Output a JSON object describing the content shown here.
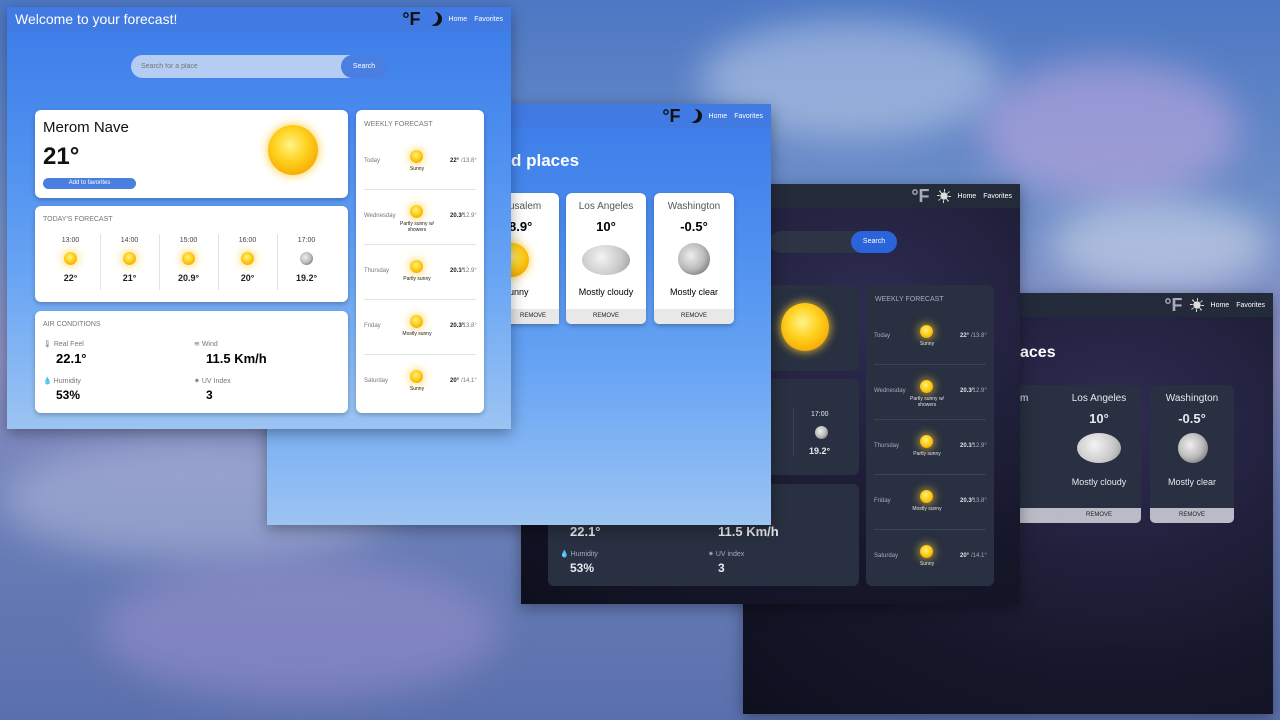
{
  "nav": {
    "title": "Welcome to your forecast!",
    "unit": "°F",
    "home": "Home",
    "favorites": "Favorites"
  },
  "search": {
    "placeholder": "Search for a place",
    "button": "Search"
  },
  "current": {
    "city": "Merom Nave",
    "temp": "21°",
    "add_fav": "Add to favorites"
  },
  "today": {
    "title": "TODAY'S FORECAST",
    "hours": [
      {
        "time": "13:00",
        "temp": "22°",
        "icon": "sun-icon"
      },
      {
        "time": "14:00",
        "temp": "21°",
        "icon": "sun-icon"
      },
      {
        "time": "15:00",
        "temp": "20.9°",
        "icon": "sun-icon"
      },
      {
        "time": "16:00",
        "temp": "20°",
        "icon": "sun-icon"
      },
      {
        "time": "17:00",
        "temp": "19.2°",
        "icon": "moon-icon"
      }
    ]
  },
  "air": {
    "title": "AIR CONDITIONS",
    "real_feel_label": "Real Feel",
    "real_feel": "22.1°",
    "wind_label": "Wind",
    "wind": "11.5 Km/h",
    "humidity_label": "Humidity",
    "humidity": "53%",
    "uv_label": "UV Index",
    "uv": "3",
    "uv_label_dark": "UV index"
  },
  "weekly": {
    "title": "WEEKLY FORECAST",
    "days": [
      {
        "day": "Today",
        "desc": "Sunny",
        "hi": "22°",
        "lo": "/13.8°"
      },
      {
        "day": "Wednesday",
        "desc": "Partly sunny w/ showers",
        "hi": "20.3°",
        "lo": "/12.9°"
      },
      {
        "day": "Thursday",
        "desc": "Partly sunny",
        "hi": "20.1°",
        "lo": "/12.9°"
      },
      {
        "day": "Friday",
        "desc": "Mostly sunny",
        "hi": "20.3°",
        "lo": "/13.8°"
      },
      {
        "day": "Saturday",
        "desc": "Sunny",
        "hi": "20°",
        "lo": "/14.1°"
      }
    ]
  },
  "favorites": {
    "title_fragment": "d places",
    "title_fragment_dark": "aces",
    "cards": [
      {
        "city": "usalem",
        "temp": "8.9°",
        "desc": "unny",
        "remove": "REMOVE"
      },
      {
        "city": "Los Angeles",
        "temp": "10°",
        "desc": "Mostly cloudy",
        "remove": "REMOVE"
      },
      {
        "city": "Washington",
        "temp": "-0.5°",
        "desc": "Mostly clear",
        "remove": "REMOVE"
      }
    ],
    "dark_partial_city": "m"
  },
  "colors": {
    "accent": "#4a7ee0",
    "dark_card": "#283041",
    "dark_nav": "#232a3a"
  }
}
